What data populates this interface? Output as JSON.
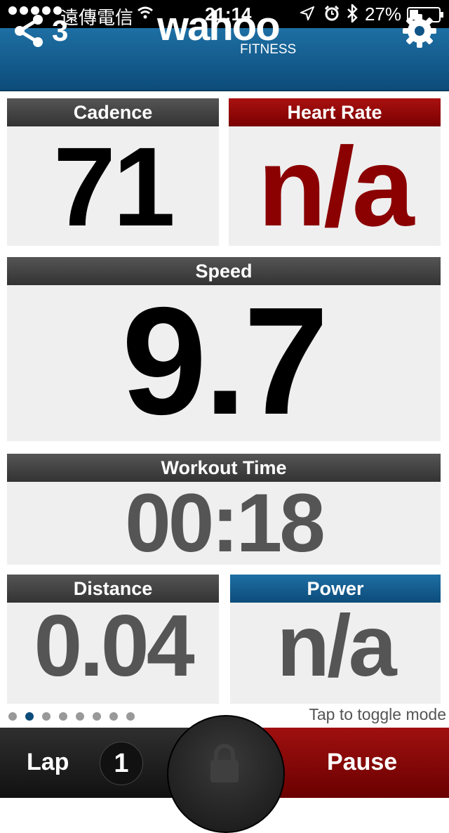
{
  "status_bar": {
    "carrier": "遠傳電信",
    "time": "21:14",
    "battery": "27%",
    "icons": [
      "signal-dots-icon",
      "wifi-icon",
      "location-arrow-icon",
      "alarm-icon",
      "bluetooth-icon",
      "battery-icon"
    ]
  },
  "header": {
    "share_count": "3",
    "logo_main": "wahoo",
    "logo_sub": "FITNESS",
    "icons": [
      "share-icon",
      "gear-icon"
    ]
  },
  "tiles": {
    "cadence": {
      "label": "Cadence",
      "value": "71"
    },
    "heart_rate": {
      "label": "Heart Rate",
      "value": "n/a"
    },
    "speed": {
      "label": "Speed",
      "value": "9.7"
    },
    "workout_time": {
      "label": "Workout Time",
      "value": "00:18"
    },
    "distance": {
      "label": "Distance",
      "value": "0.04"
    },
    "power": {
      "label": "Power",
      "value": "n/a"
    }
  },
  "pager": {
    "pages": 8,
    "active": 2
  },
  "hint": "Tap to toggle mode",
  "bottom": {
    "lap_label": "Lap",
    "lap_count": "1",
    "pause_label": "Pause",
    "icons": [
      "lock-icon"
    ]
  },
  "colors": {
    "header_blue": "#0c4c7a",
    "alert_red": "#8b0000",
    "tile_bg": "#efefef"
  }
}
